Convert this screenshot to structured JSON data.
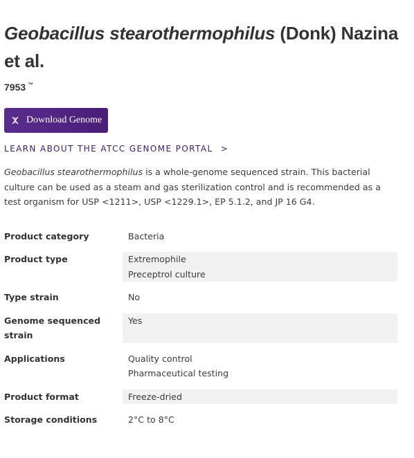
{
  "product": {
    "species": "Geobacillus stearothermophilus",
    "authority": "(Donk) Nazina et al.",
    "catalog_number": "7953",
    "trademark": "™"
  },
  "download_button": {
    "label": "Download Genome",
    "icon": "dna-icon"
  },
  "learn_link": {
    "label": "LEARN ABOUT THE ATCC GENOME PORTAL",
    "chevron": ">"
  },
  "description": {
    "species": "Geobacillus stearothermophilus",
    "text": " is a whole-genome sequenced strain. This bacterial culture can be used as a steam and gas sterilization control and is recommended as a test organism for USP <1211>, USP <1229.1>, EP 5.1.2, and JP 16 G4."
  },
  "specs": {
    "product_category": {
      "label": "Product category",
      "values": [
        "Bacteria"
      ]
    },
    "product_type": {
      "label": "Product type",
      "values": [
        "Extremophile",
        "Preceptrol culture"
      ]
    },
    "type_strain": {
      "label": "Type strain",
      "values": [
        "No"
      ]
    },
    "genome_sequenced_strain": {
      "label": "Genome sequenced strain",
      "values": [
        "Yes"
      ]
    },
    "applications": {
      "label": "Applications",
      "values": [
        "Quality control",
        "Pharmaceutical testing"
      ]
    },
    "product_format": {
      "label": "Product format",
      "values": [
        "Freeze-dried"
      ]
    },
    "storage_conditions": {
      "label": "Storage conditions",
      "values": [
        "2°C to 8°C"
      ]
    }
  },
  "colors": {
    "button_bg": "#5a2c8e",
    "link": "#3b1b6b",
    "shaded_row": "#f1f1f1"
  }
}
